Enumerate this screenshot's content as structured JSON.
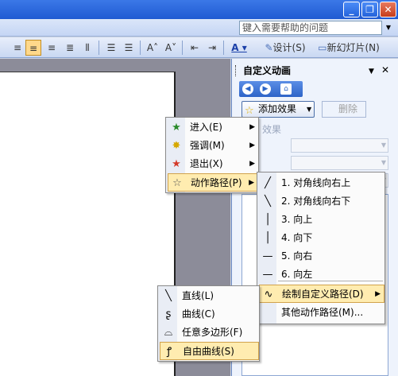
{
  "window": {
    "minimize": "_",
    "restore": "❐",
    "close": "✕"
  },
  "menubar": {
    "help_placeholder": "键入需要帮助的问题",
    "help_dropdown_icon": "dropdown-arrow-icon"
  },
  "toolbar": {
    "design_label": "设计(S)",
    "new_slide_label": "新幻灯片(N)",
    "active_alignment": "align-center"
  },
  "pane": {
    "title": "自定义动画",
    "add_effect": "添加效果",
    "delete": "删除",
    "effect_label": "效果"
  },
  "effects_menu": {
    "items": [
      {
        "label": "进入(E)",
        "icon": "entrance-star-icon",
        "color": "#2a8a2a"
      },
      {
        "label": "强调(M)",
        "icon": "emphasis-star-icon",
        "color": "#d6a800"
      },
      {
        "label": "退出(X)",
        "icon": "exit-star-icon",
        "color": "#d43a2a"
      },
      {
        "label": "动作路径(P)",
        "icon": "motion-path-star-icon",
        "color": "#777777"
      }
    ],
    "highlighted": 3
  },
  "paths_menu": {
    "items": [
      {
        "label": "1. 对角线向右上",
        "icon": "diagonal-up-right-icon"
      },
      {
        "label": "2. 对角线向右下",
        "icon": "diagonal-down-right-icon"
      },
      {
        "label": "3. 向上",
        "icon": "path-up-icon"
      },
      {
        "label": "4. 向下",
        "icon": "path-down-icon"
      },
      {
        "label": "5. 向右",
        "icon": "path-right-icon"
      },
      {
        "label": "6. 向左",
        "icon": "path-left-icon"
      },
      {
        "label": "绘制自定义路径(D)",
        "icon": "draw-custom-path-icon"
      },
      {
        "label": "其他动作路径(M)...",
        "icon": ""
      }
    ],
    "highlighted": 6
  },
  "custom_menu": {
    "items": [
      {
        "label": "直线(L)",
        "icon": "line-icon"
      },
      {
        "label": "曲线(C)",
        "icon": "curve-icon"
      },
      {
        "label": "任意多边形(F)",
        "icon": "freeform-icon"
      },
      {
        "label": "自由曲线(S)",
        "icon": "scribble-icon"
      }
    ],
    "highlighted": 3
  }
}
